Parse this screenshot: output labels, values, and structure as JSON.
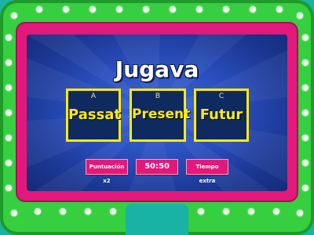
{
  "question": {
    "text": "Jugava"
  },
  "answers": [
    {
      "letter": "A",
      "label": "Passat"
    },
    {
      "letter": "B",
      "label": "Present"
    },
    {
      "letter": "C",
      "label": "Futur"
    }
  ],
  "lifelines": {
    "double_score": "Puntuación x2",
    "fifty_fifty": "50:50",
    "extra_time": "Tiempo extra"
  },
  "colors": {
    "frame_green": "#35cf3f",
    "frame_pink": "#e2197a",
    "screen_blue": "#2a4fbf",
    "answer_yellow": "#ffea12",
    "answer_bg": "#0f2a5e"
  }
}
